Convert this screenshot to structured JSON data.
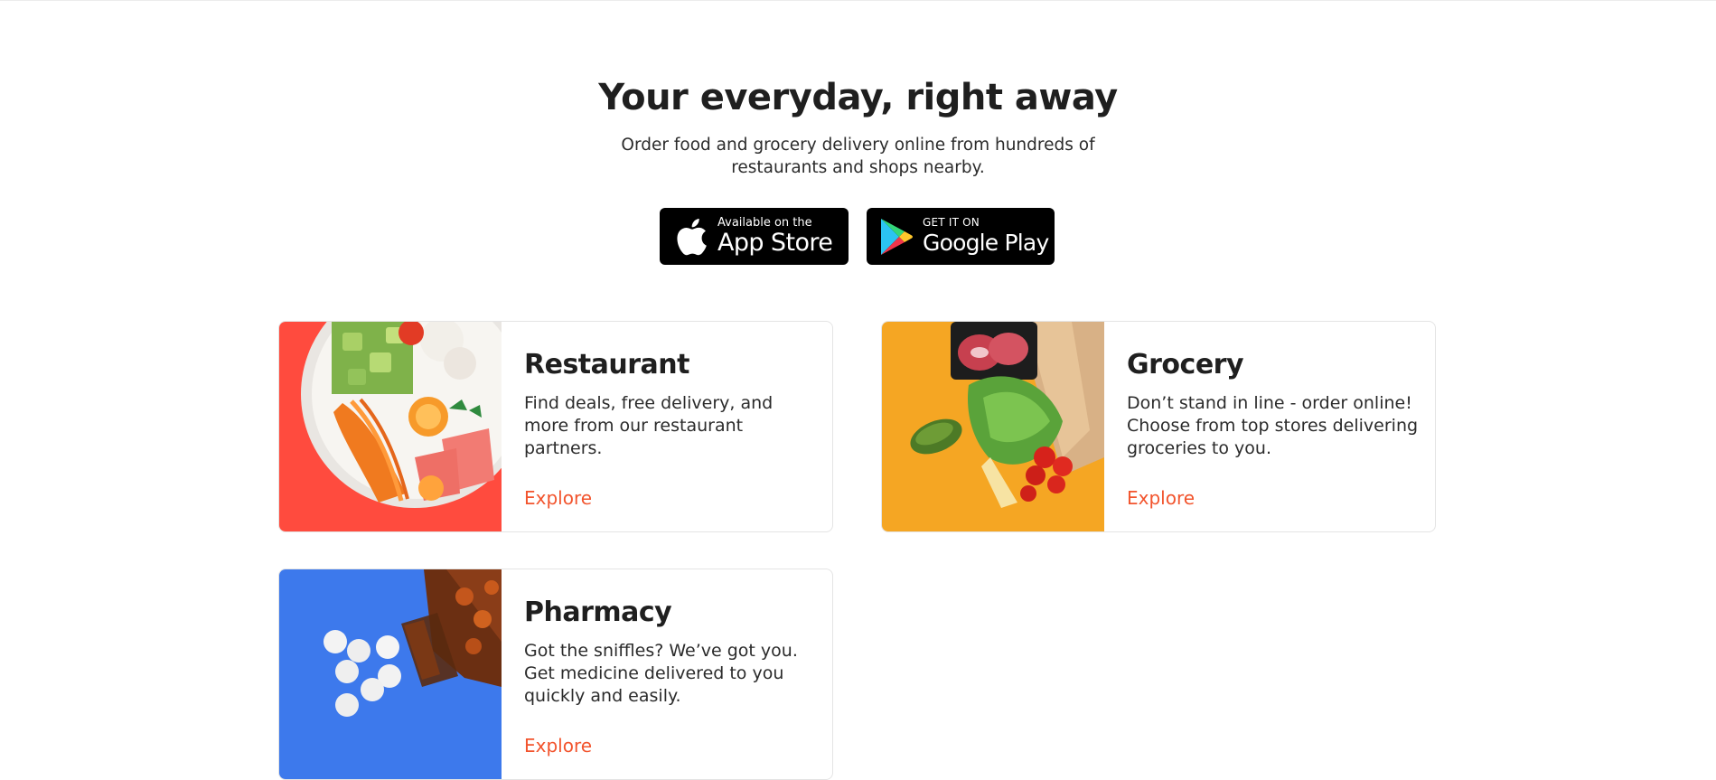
{
  "hero": {
    "title": "Your everyday, right away",
    "subtitle": "Order food and grocery delivery online from hundreds of restaurants and shops nearby."
  },
  "store_badges": {
    "apple": {
      "small": "Available on the",
      "big": "App Store",
      "icon": "apple-icon"
    },
    "google": {
      "small": "GET IT ON",
      "big": "Google Play",
      "icon": "google-play-icon"
    }
  },
  "cards": [
    {
      "title": "Restaurant",
      "description": "Find deals, free delivery, and more from our restaurant partners.",
      "link": "Explore",
      "image": "poke-bowl-image",
      "color": "#ff4b3e"
    },
    {
      "title": "Grocery",
      "description": "Don’t stand in line - order online! Choose from top stores delivering groceries to you.",
      "link": "Explore",
      "image": "grocery-bag-image",
      "color": "#f5a623"
    },
    {
      "title": "Pharmacy",
      "description": "Got the sniffles? We’ve got you. Get medicine delivered to you quickly and easily.",
      "link": "Explore",
      "image": "pill-bottle-image",
      "color": "#3d79ec"
    }
  ],
  "colors": {
    "accent": "#f2542d",
    "text": "#1f1f1f"
  }
}
